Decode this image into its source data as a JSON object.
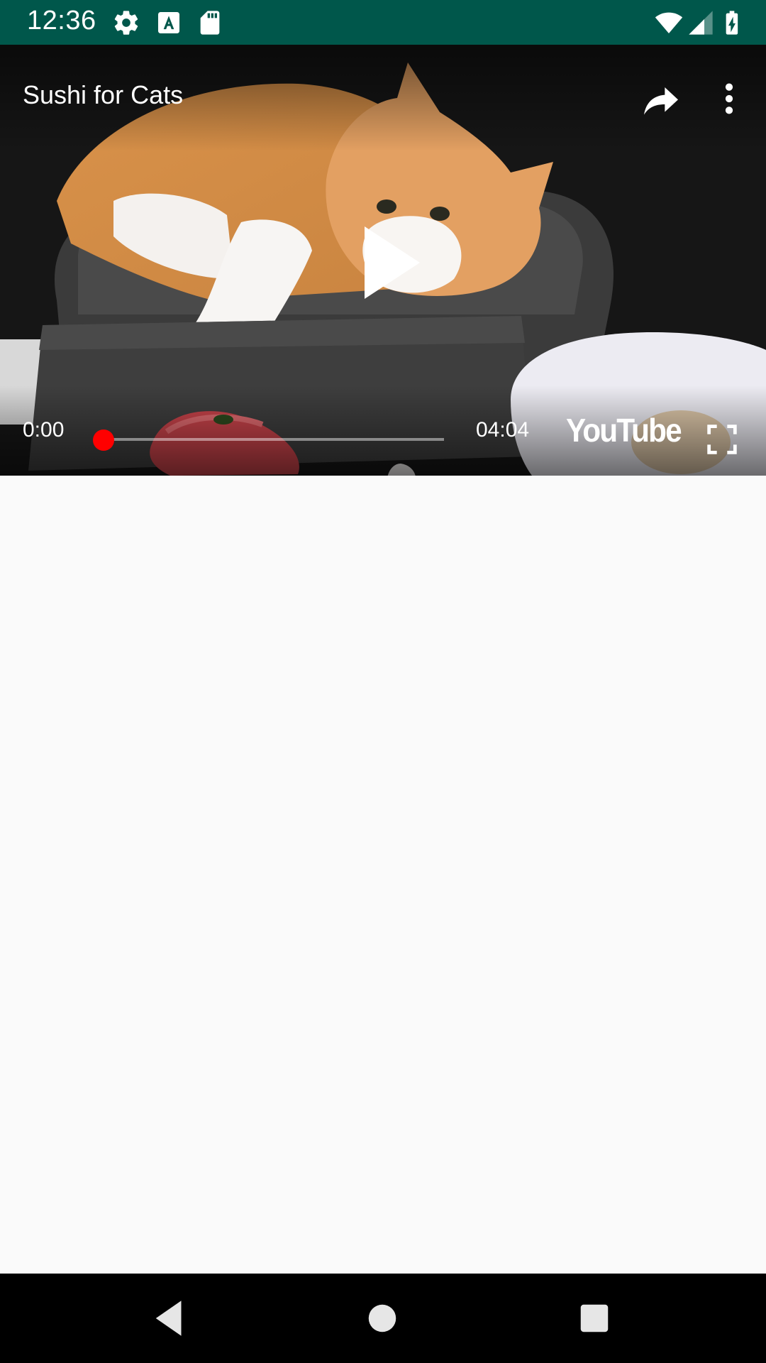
{
  "status_bar": {
    "time": "12:36",
    "left_icons": [
      "settings-icon",
      "font-a-icon",
      "sd-card-icon"
    ],
    "right_icons": [
      "wifi-icon",
      "cell-signal-icon",
      "battery-icon"
    ],
    "background": "#00574b"
  },
  "player": {
    "video_title": "Sushi for Cats",
    "current_time": "0:00",
    "duration": "04:04",
    "progress": 0,
    "brand": "YouTube",
    "accent_color": "#ff0000",
    "icons": [
      "share-icon",
      "more-vert-icon",
      "play-icon",
      "fullscreen-icon"
    ]
  },
  "navigation_bar": {
    "buttons": [
      "back-icon",
      "home-icon",
      "recents-icon"
    ]
  }
}
